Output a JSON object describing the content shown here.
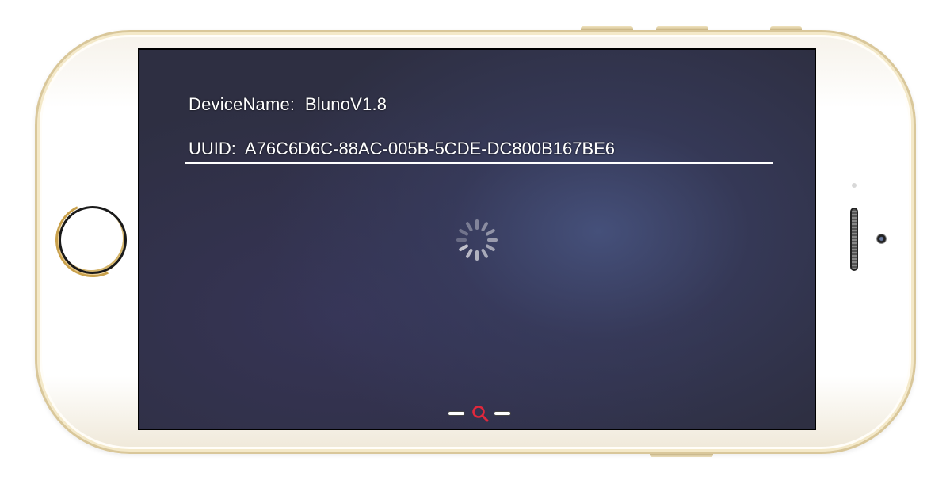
{
  "device": {
    "name_label": "DeviceName:",
    "name_value": "BlunoV1.8",
    "uuid_label": "UUID:",
    "uuid_value": "A76C6D6C-88AC-005B-5CDE-DC800B167BE6"
  },
  "status": {
    "loading": true
  },
  "scan_control": {
    "icon": "search-icon",
    "icon_color": "#e0283c"
  },
  "colors": {
    "screen_background": "#2e2f42",
    "text": "#ffffff",
    "phone_trim": "#d9c79a"
  }
}
